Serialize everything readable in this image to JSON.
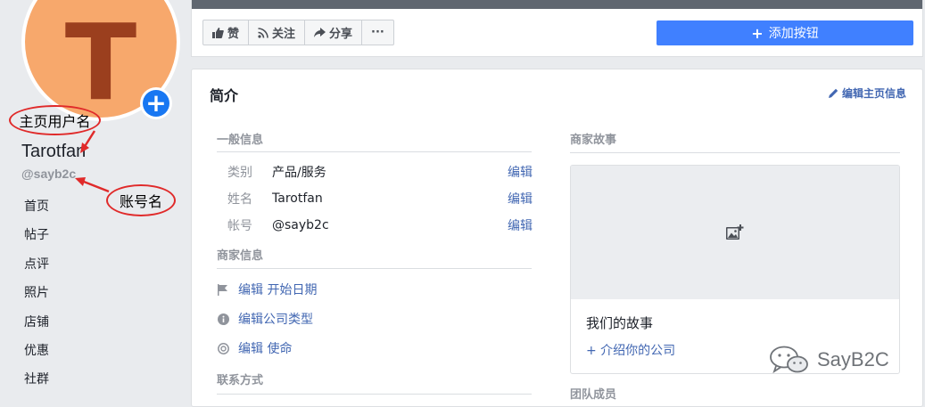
{
  "profile": {
    "avatar_letter": "T",
    "avatar_color": "#f7a86c",
    "name": "Tarotfan",
    "handle": "@sayb2c"
  },
  "annotations": {
    "page_username": "主页用户名",
    "account_name": "账号名"
  },
  "nav": [
    "首页",
    "帖子",
    "点评",
    "照片",
    "店铺",
    "优惠",
    "社群"
  ],
  "toolbar": {
    "like": "赞",
    "follow": "关注",
    "share": "分享",
    "more": "···",
    "add_button": "添加按钮"
  },
  "about": {
    "title": "简介",
    "edit_page_info": "编辑主页信息",
    "general": {
      "heading": "一般信息",
      "rows": [
        {
          "key": "类别",
          "value": "产品/服务",
          "edit": "编辑"
        },
        {
          "key": "姓名",
          "value": "Tarotfan",
          "edit": "编辑"
        },
        {
          "key": "帐号",
          "value": "@sayb2c",
          "edit": "编辑"
        }
      ]
    },
    "business": {
      "heading": "商家信息",
      "items": [
        {
          "icon": "flag-icon",
          "label": "编辑 开始日期"
        },
        {
          "icon": "info-icon",
          "label": "编辑公司类型"
        },
        {
          "icon": "mission-icon",
          "label": "编辑 使命"
        }
      ]
    },
    "contact": {
      "heading": "联系方式"
    },
    "story": {
      "heading": "商家故事",
      "title": "我们的故事",
      "link": "+ 介绍你的公司"
    },
    "team": {
      "heading": "团队成员"
    }
  },
  "watermark": "SayB2C",
  "colors": {
    "brand_blue": "#4080ff",
    "link_blue": "#4267b2",
    "annotation_red": "#e02a2a"
  }
}
